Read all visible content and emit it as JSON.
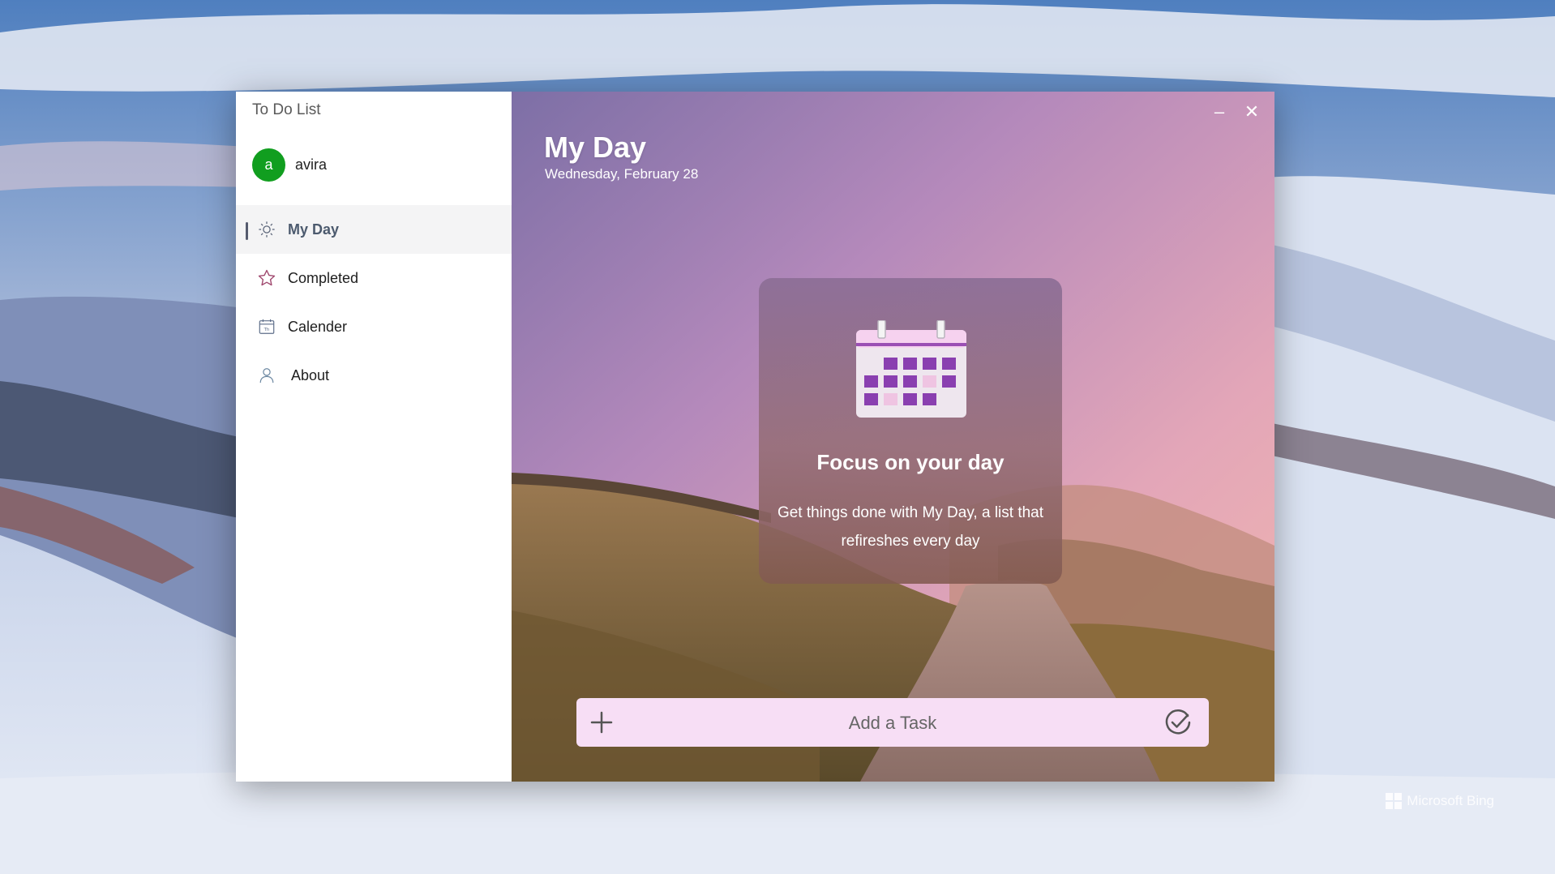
{
  "app": {
    "title": "To Do List"
  },
  "user": {
    "initial": "a",
    "name": "avira",
    "avatar_color": "#119e1f"
  },
  "sidebar": {
    "items": [
      {
        "label": "My Day",
        "icon": "sun-icon",
        "active": true
      },
      {
        "label": "Completed",
        "icon": "star-icon",
        "active": false
      },
      {
        "label": "Calender",
        "icon": "calendar-icon",
        "active": false
      },
      {
        "label": "About",
        "icon": "person-icon",
        "active": false
      }
    ]
  },
  "window_controls": {
    "minimize": "–",
    "close": "✕"
  },
  "main": {
    "title": "My Day",
    "date": "Wednesday, February 28",
    "focus_card": {
      "heading": "Focus on your day",
      "body": "Get things done with My Day, a list that refireshes every day",
      "illustration": "calendar-illustration"
    },
    "add_task": {
      "placeholder": "Add a Task",
      "plus_icon": "plus-icon",
      "submit_icon": "check-circle-icon"
    }
  },
  "desktop": {
    "watermark": "Microsoft Bing"
  },
  "colors": {
    "accent": "#8e44ad",
    "input_bg": "#f7def5",
    "nav_active_bg": "#f4f4f5"
  }
}
